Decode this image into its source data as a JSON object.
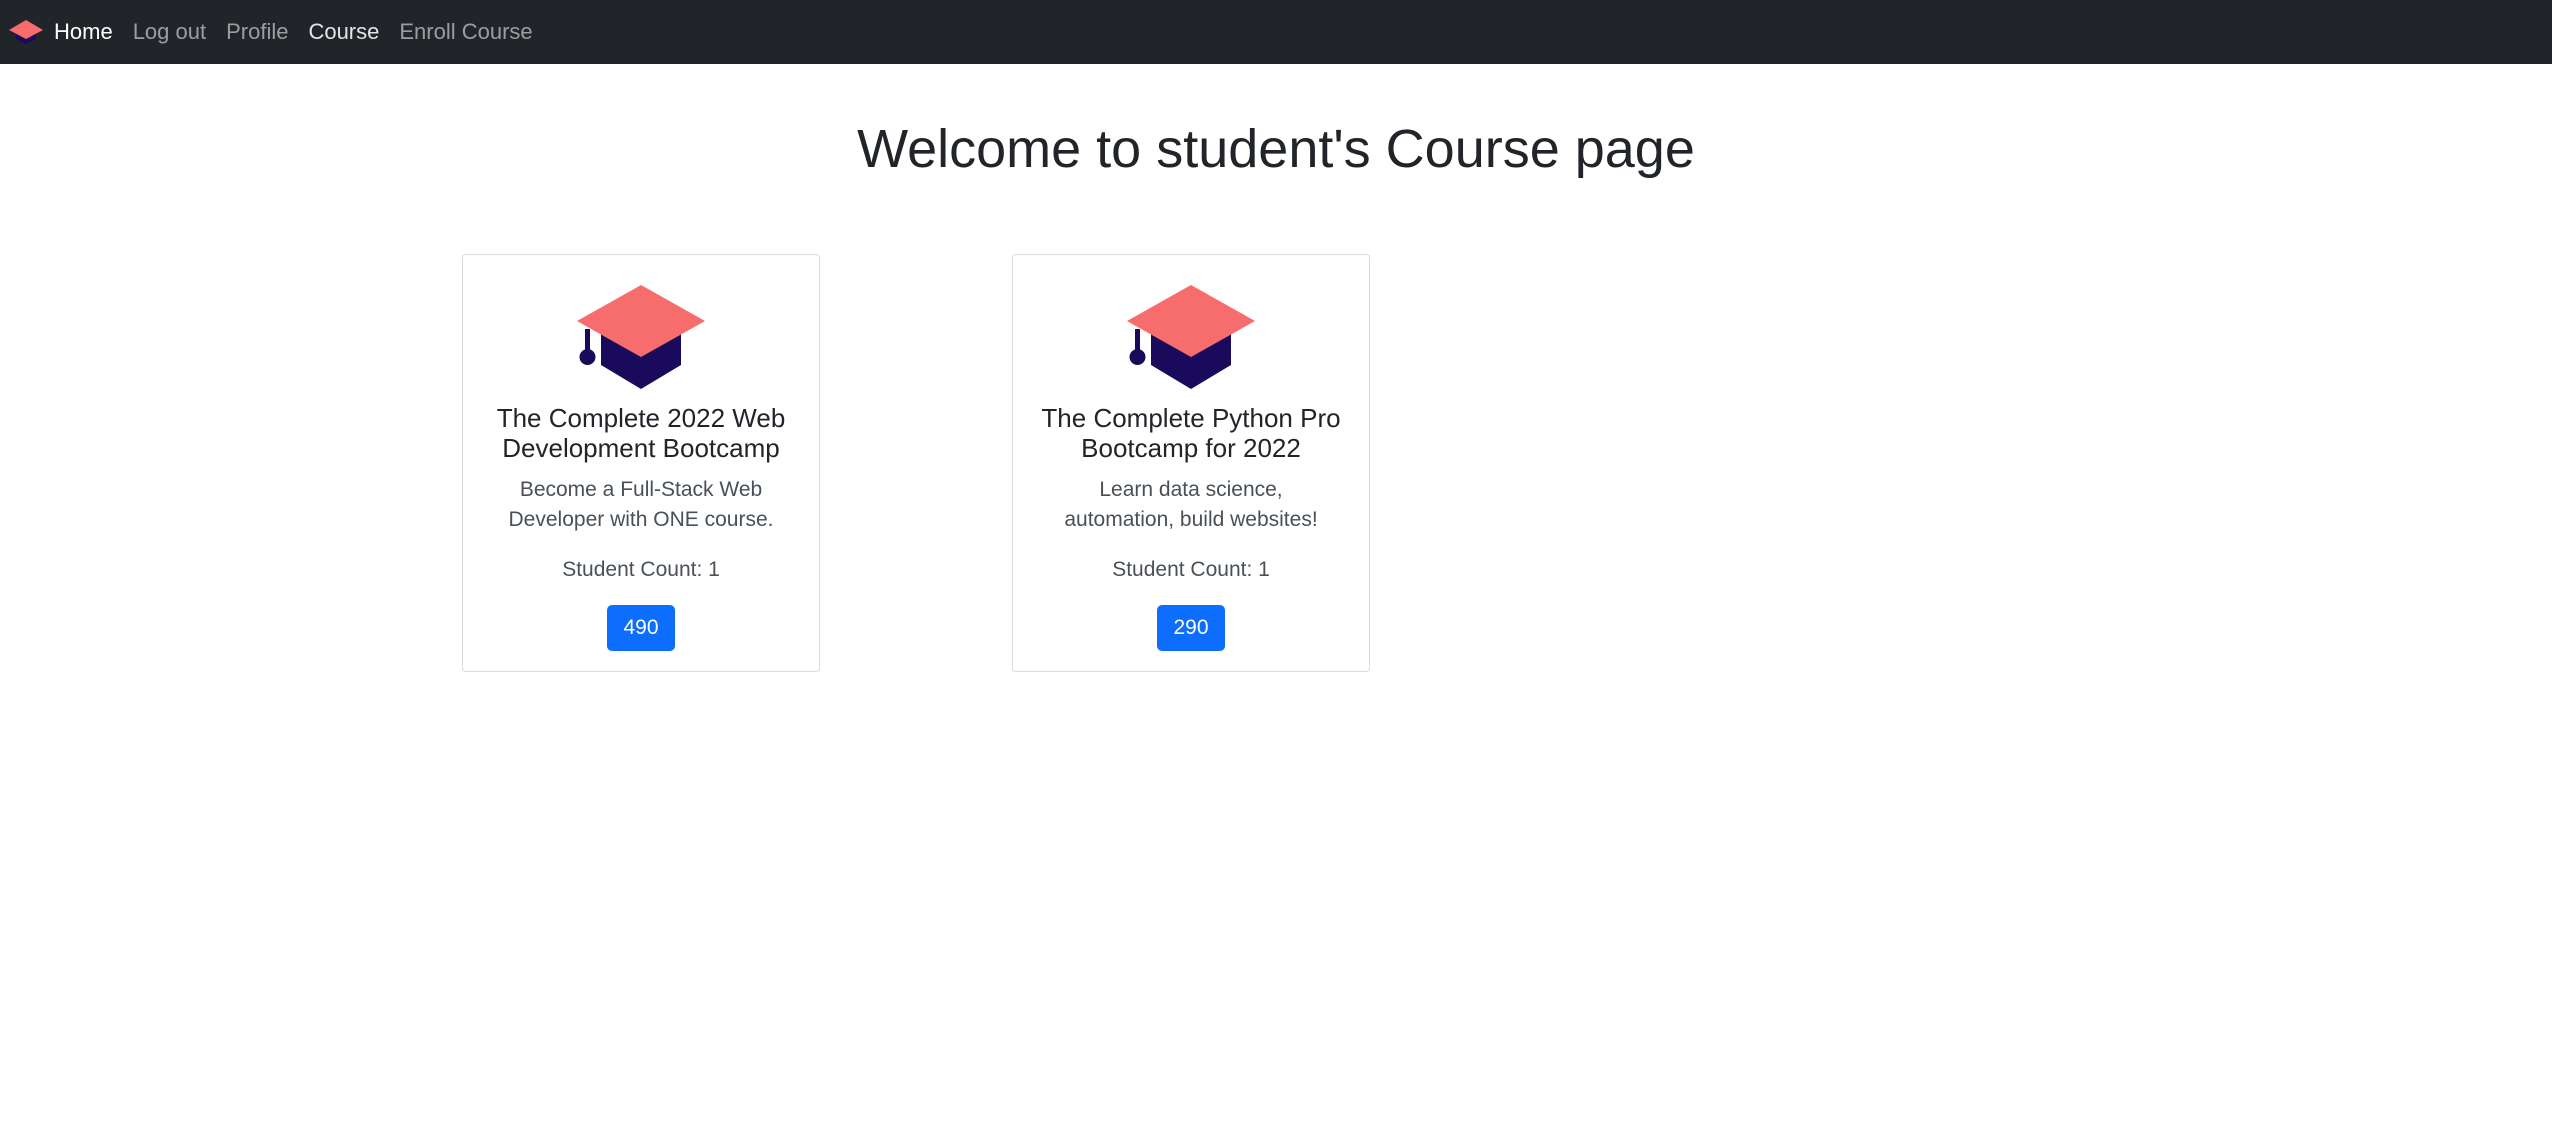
{
  "nav": {
    "logo_icon": "graduation-cap-icon",
    "links": [
      "Home",
      "Log out",
      "Profile",
      "Course",
      "Enroll Course"
    ]
  },
  "page": {
    "title": "Welcome to student's Course page"
  },
  "colors": {
    "navbar_bg": "#212529",
    "cap_top": "#f76c6c",
    "cap_base": "#1a0a5c",
    "button": "#0d6efd"
  },
  "courses": [
    {
      "icon": "graduation-cap-icon",
      "title": "The Complete 2022 Web Development Bootcamp",
      "description": "Become a Full-Stack Web Developer with ONE course.",
      "student_count": "Student Count: 1",
      "price": "490"
    },
    {
      "icon": "graduation-cap-icon",
      "title": "The Complete Python Pro Bootcamp for 2022",
      "description": "Learn data science, automation, build websites!",
      "student_count": "Student Count: 1",
      "price": "290"
    }
  ]
}
